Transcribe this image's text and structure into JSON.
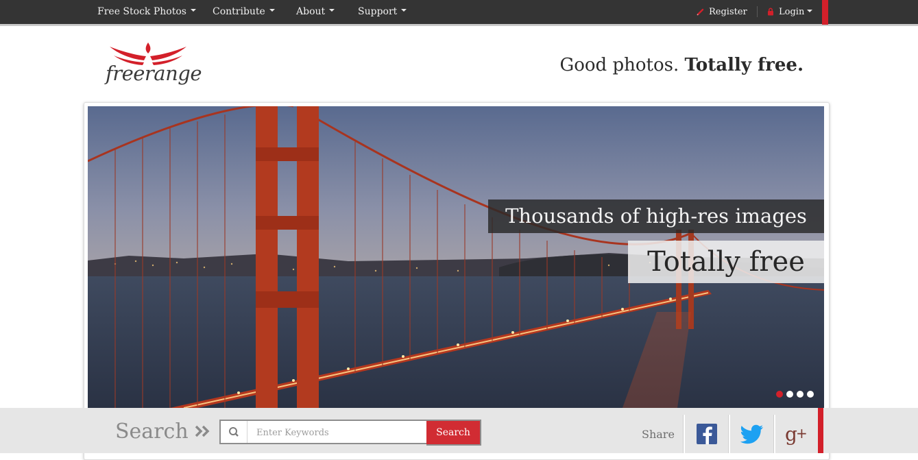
{
  "nav": {
    "items": [
      {
        "label": "Free Stock Photos"
      },
      {
        "label": "Contribute"
      },
      {
        "label": "About"
      },
      {
        "label": "Support"
      }
    ],
    "register_label": "Register",
    "login_label": "Login"
  },
  "header": {
    "logo_text": "freerange",
    "tagline_plain": "Good photos.",
    "tagline_bold": "Totally free."
  },
  "hero": {
    "caption_line1": "Thousands of high-res images",
    "caption_line2": "Totally free",
    "slide_count": 4,
    "active_slide": 1
  },
  "search": {
    "label": "Search",
    "placeholder": "Enter Keywords",
    "button_label": "Search"
  },
  "share": {
    "label": "Share",
    "networks": [
      "facebook-icon",
      "twitter-icon",
      "google-plus-icon"
    ]
  },
  "colors": {
    "brand_red": "#d3202a",
    "nav_bg": "#343434",
    "search_bar_bg": "#e6e6e6",
    "facebook_blue": "#3b5998",
    "twitter_blue": "#1da1f2"
  }
}
